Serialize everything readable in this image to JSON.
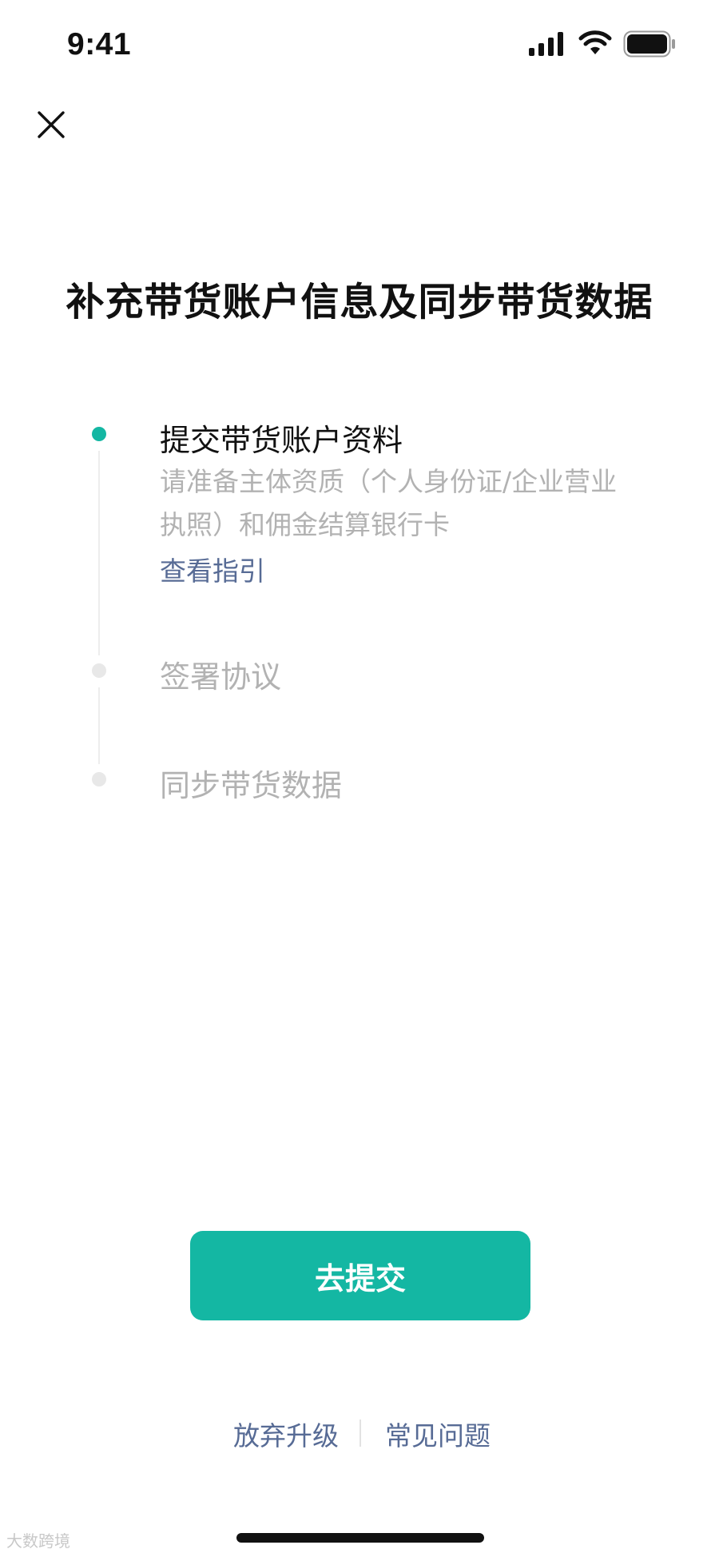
{
  "status_bar": {
    "time": "9:41",
    "icons": [
      "signal-icon",
      "wifi-icon",
      "battery-icon"
    ]
  },
  "header": {
    "close_icon": "close-icon"
  },
  "title": "补充带货账户信息及同步带货数据",
  "steps": [
    {
      "title": "提交带货账户资料",
      "description": "请准备主体资质（个人身份证/企业营业执照）和佣金结算银行卡",
      "link": "查看指引",
      "active": true
    },
    {
      "title": "签署协议",
      "active": false
    },
    {
      "title": "同步带货数据",
      "active": false
    }
  ],
  "primary_button": "去提交",
  "footer_links": {
    "abandon": "放弃升级",
    "faq": "常见问题"
  },
  "watermark": "大数跨境",
  "colors": {
    "accent": "#14b7a3",
    "link": "#576b95",
    "inactive_text": "#b2b2b2",
    "inactive_dot": "#e8e8e8"
  }
}
